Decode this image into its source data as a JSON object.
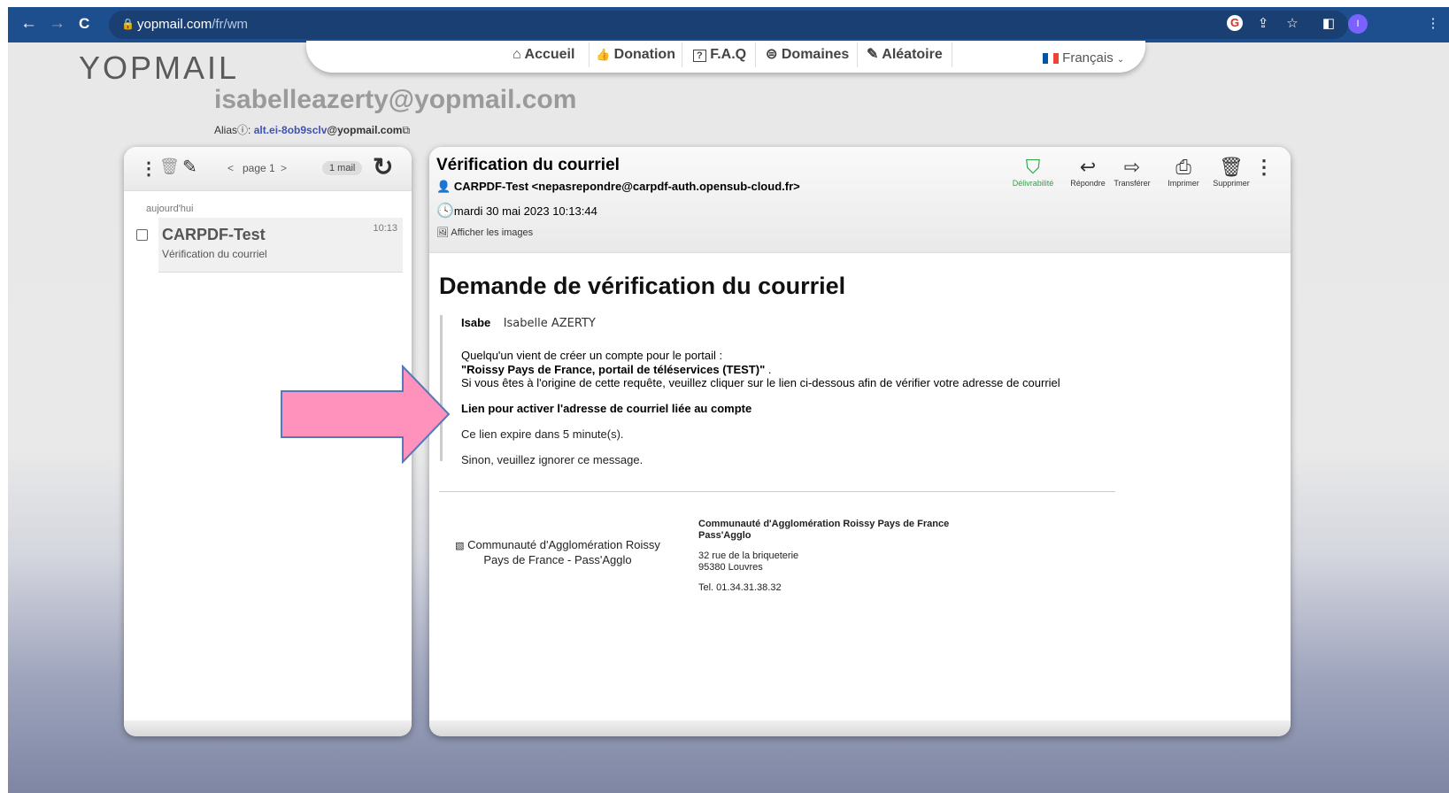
{
  "browser": {
    "url_host": "yopmail.com",
    "url_path": "/fr/wm",
    "back_glyph": "←",
    "forward_glyph": "→",
    "reload_glyph": "C",
    "profile_initial": "I"
  },
  "site": {
    "logo_text": "YOPMAIL",
    "nav": [
      {
        "icon": "⌂",
        "label": "Accueil"
      },
      {
        "icon": "👍",
        "label": "Donation"
      },
      {
        "icon": "?",
        "label": "F.A.Q"
      },
      {
        "icon": "⊜",
        "label": "Domaines"
      },
      {
        "icon": "✎",
        "label": "Aléatoire"
      }
    ],
    "language": "Français",
    "mailbox_address": "isabelleazerty@yopmail.com",
    "alias_label": "Alias",
    "alias_highlight": "alt.ei-8ob9sclv",
    "alias_domain": "@yopmail.com"
  },
  "inbox": {
    "page_label": "page 1",
    "mail_count": "1 mail",
    "date_group": "aujourd'hui",
    "messages": [
      {
        "sender": "CARPDF-Test",
        "subject": "Vérification du courriel",
        "time": "10:13"
      }
    ]
  },
  "message": {
    "subject": "Vérification du courriel",
    "from": "CARPDF-Test <nepasrepondre@carpdf-auth.opensub-cloud.fr>",
    "date": "mardi 30 mai 2023 10:13:44",
    "show_images": "Afficher les images",
    "actions": [
      {
        "icon": "shield-check",
        "label": "Délivrabilité",
        "color": "#27a745"
      },
      {
        "icon": "reply",
        "label": "Répondre"
      },
      {
        "icon": "forward",
        "label": "Transférer"
      },
      {
        "icon": "printer",
        "label": "Imprimer"
      },
      {
        "icon": "trash",
        "label": "Supprimer"
      }
    ],
    "body": {
      "heading": "Demande de vérification du courriel",
      "greeting_bold": "Isabe",
      "greeting_name": "Isabelle AZERTY",
      "line1": "Quelqu'un vient de créer un compte pour le portail :",
      "portal_name": "\"Roissy Pays de France, portail de téléservices (TEST)\"",
      "portal_suffix": " .",
      "line2": "Si vous êtes à l'origine de cette requête, veuillez cliquer sur le lien ci-dessous afin de vérifier votre adresse de courriel",
      "link_text": "Lien pour activer l'adresse de courriel liée au compte",
      "expiry": "Ce lien expire dans 5 minute(s).",
      "ignore": "Sinon, veuillez ignorer ce message."
    },
    "footer": {
      "image_alt": "Communauté d'Agglomération Roissy Pays de France - Pass'Agglo",
      "org_name": "Communauté d'Agglomération Roissy Pays de France",
      "org_sub": "Pass'Agglo",
      "address1": "32 rue de la briqueterie",
      "address2": "95380 Louvres",
      "phone": "Tel. 01.34.31.38.32"
    }
  },
  "colors": {
    "chrome": "#1d4e8d",
    "annotation_arrow": "#ff92bd",
    "arrow_outline": "#5578b8"
  }
}
